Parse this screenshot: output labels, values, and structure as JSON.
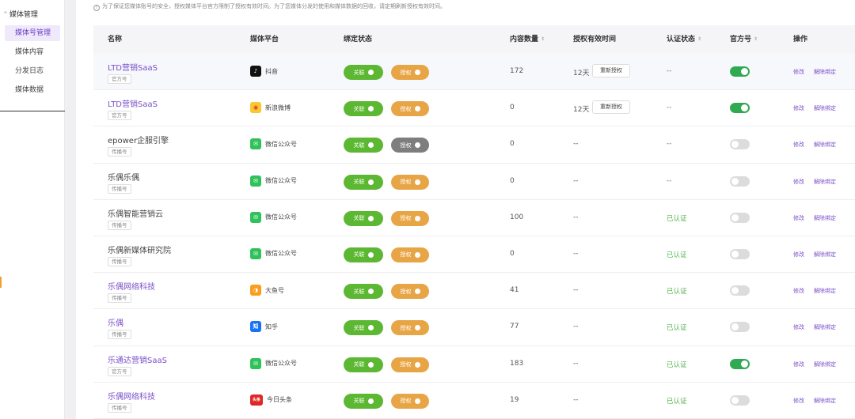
{
  "sidebar": {
    "group_label": "媒体管理",
    "items": [
      {
        "label": "媒体号管理",
        "active": true
      },
      {
        "label": "媒体内容",
        "active": false
      },
      {
        "label": "分发日志",
        "active": false
      },
      {
        "label": "媒体数据",
        "active": false
      }
    ]
  },
  "notice": "为了保证您媒体账号的安全，授权媒体平台官方限制了授权有效时间。为了您媒体分发的使用和媒体数据的回收，请定期刷新授权有效时间。",
  "columns": {
    "name": "名称",
    "platform": "媒体平台",
    "bind_status": "绑定状态",
    "content_count": "内容数量",
    "auth_valid": "授权有效时间",
    "cert_status": "认证状态",
    "official": "官方号",
    "actions": "操作"
  },
  "labels": {
    "link": "关联",
    "auth": "授权",
    "reauth": "重新授权",
    "edit": "修改",
    "unbind": "解除绑定"
  },
  "rows": [
    {
      "name": "LTD营销SaaS",
      "tag": "官方号",
      "platform": "抖音",
      "platform_icon": "douyin-icon",
      "auth_color": "orange",
      "count": "172",
      "valid": "12天",
      "reauth": true,
      "cert": "--",
      "official_on": true
    },
    {
      "name": "LTD营销SaaS",
      "tag": "官方号",
      "platform": "新浪微博",
      "platform_icon": "weibo-icon",
      "auth_color": "orange",
      "count": "0",
      "valid": "12天",
      "reauth": true,
      "cert": "--",
      "official_on": true
    },
    {
      "name": "epower企服引擎",
      "tag": "传播号",
      "platform": "微信公众号",
      "platform_icon": "wechat-icon",
      "auth_color": "gray",
      "count": "0",
      "valid": "--",
      "reauth": false,
      "cert": "--",
      "official_on": false
    },
    {
      "name": "乐偶乐偶",
      "tag": "传播号",
      "platform": "微信公众号",
      "platform_icon": "wechat-icon",
      "auth_color": "orange",
      "count": "0",
      "valid": "--",
      "reauth": false,
      "cert": "--",
      "official_on": false
    },
    {
      "name": "乐偶智能营销云",
      "tag": "传播号",
      "platform": "微信公众号",
      "platform_icon": "wechat-icon",
      "auth_color": "orange",
      "count": "100",
      "valid": "--",
      "reauth": false,
      "cert": "已认证",
      "official_on": false
    },
    {
      "name": "乐偶新媒体研究院",
      "tag": "传播号",
      "platform": "微信公众号",
      "platform_icon": "wechat-icon",
      "auth_color": "orange",
      "count": "0",
      "valid": "--",
      "reauth": false,
      "cert": "已认证",
      "official_on": false
    },
    {
      "name": "乐偶网络科技",
      "tag": "传播号",
      "platform": "大鱼号",
      "platform_icon": "dayu-icon",
      "auth_color": "orange",
      "count": "41",
      "valid": "--",
      "reauth": false,
      "cert": "已认证",
      "official_on": false
    },
    {
      "name": "乐偶",
      "tag": "传播号",
      "platform": "知乎",
      "platform_icon": "zhihu-icon",
      "auth_color": "orange",
      "count": "77",
      "valid": "--",
      "reauth": false,
      "cert": "已认证",
      "official_on": false
    },
    {
      "name": "乐通达营销SaaS",
      "tag": "官方号",
      "platform": "微信公众号",
      "platform_icon": "wechat-icon",
      "auth_color": "orange",
      "count": "183",
      "valid": "--",
      "reauth": false,
      "cert": "已认证",
      "official_on": true
    },
    {
      "name": "乐偶网络科技",
      "tag": "传播号",
      "platform": "今日头条",
      "platform_icon": "toutiao-icon",
      "auth_color": "orange",
      "count": "19",
      "valid": "--",
      "reauth": false,
      "cert": "已认证",
      "official_on": false
    }
  ],
  "colors": {
    "accent": "#7a4fc9",
    "link_green": "#5cb832",
    "auth_orange": "#e8a545",
    "auth_gray": "#7e7e7e",
    "toggle_on": "#2faa52",
    "certified": "#52b34a"
  }
}
